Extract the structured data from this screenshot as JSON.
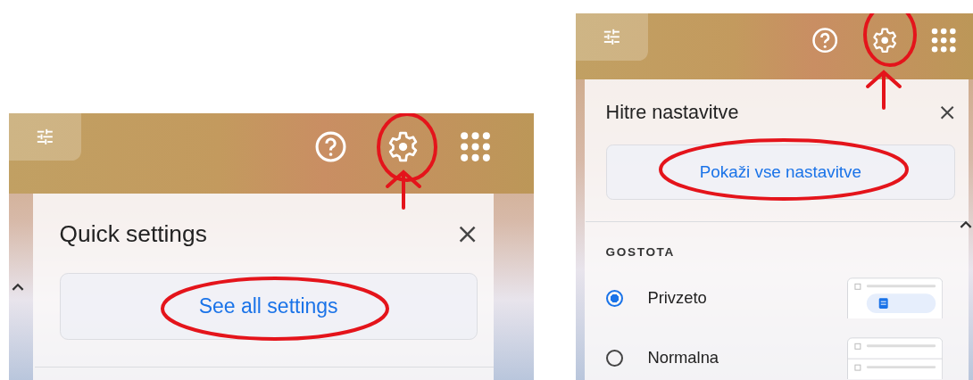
{
  "panels": [
    {
      "title": "Quick settings",
      "button": "See all settings"
    },
    {
      "title": "Hitre nastavitve",
      "button": "Pokaži vse nastavitve",
      "section": {
        "heading": "GOSTOTA",
        "options": [
          {
            "label": "Privzeto",
            "selected": true
          },
          {
            "label": "Normalna",
            "selected": false
          }
        ]
      }
    }
  ]
}
